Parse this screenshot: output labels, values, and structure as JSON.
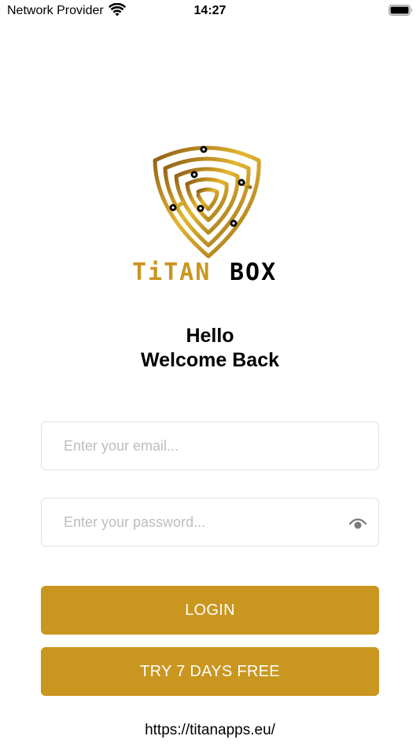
{
  "status_bar": {
    "carrier": "Network Provider",
    "time": "14:27",
    "wifi_icon": "wifi-icon",
    "battery_icon": "battery-icon"
  },
  "logo": {
    "brand_first": "TiTAN",
    "brand_second": "BOX",
    "gold_color": "#c9961f",
    "dark_color": "#000000"
  },
  "greeting": {
    "line1": "Hello",
    "line2": "Welcome Back"
  },
  "form": {
    "email_placeholder": "Enter your email...",
    "email_value": "",
    "password_placeholder": "Enter your password...",
    "password_value": "",
    "eye_icon": "eye-icon"
  },
  "buttons": {
    "login_label": "LOGIN",
    "trial_label": "TRY 7 DAYS FREE",
    "color": "#c9961f"
  },
  "footer": {
    "link_text": "https://titanapps.eu/"
  }
}
